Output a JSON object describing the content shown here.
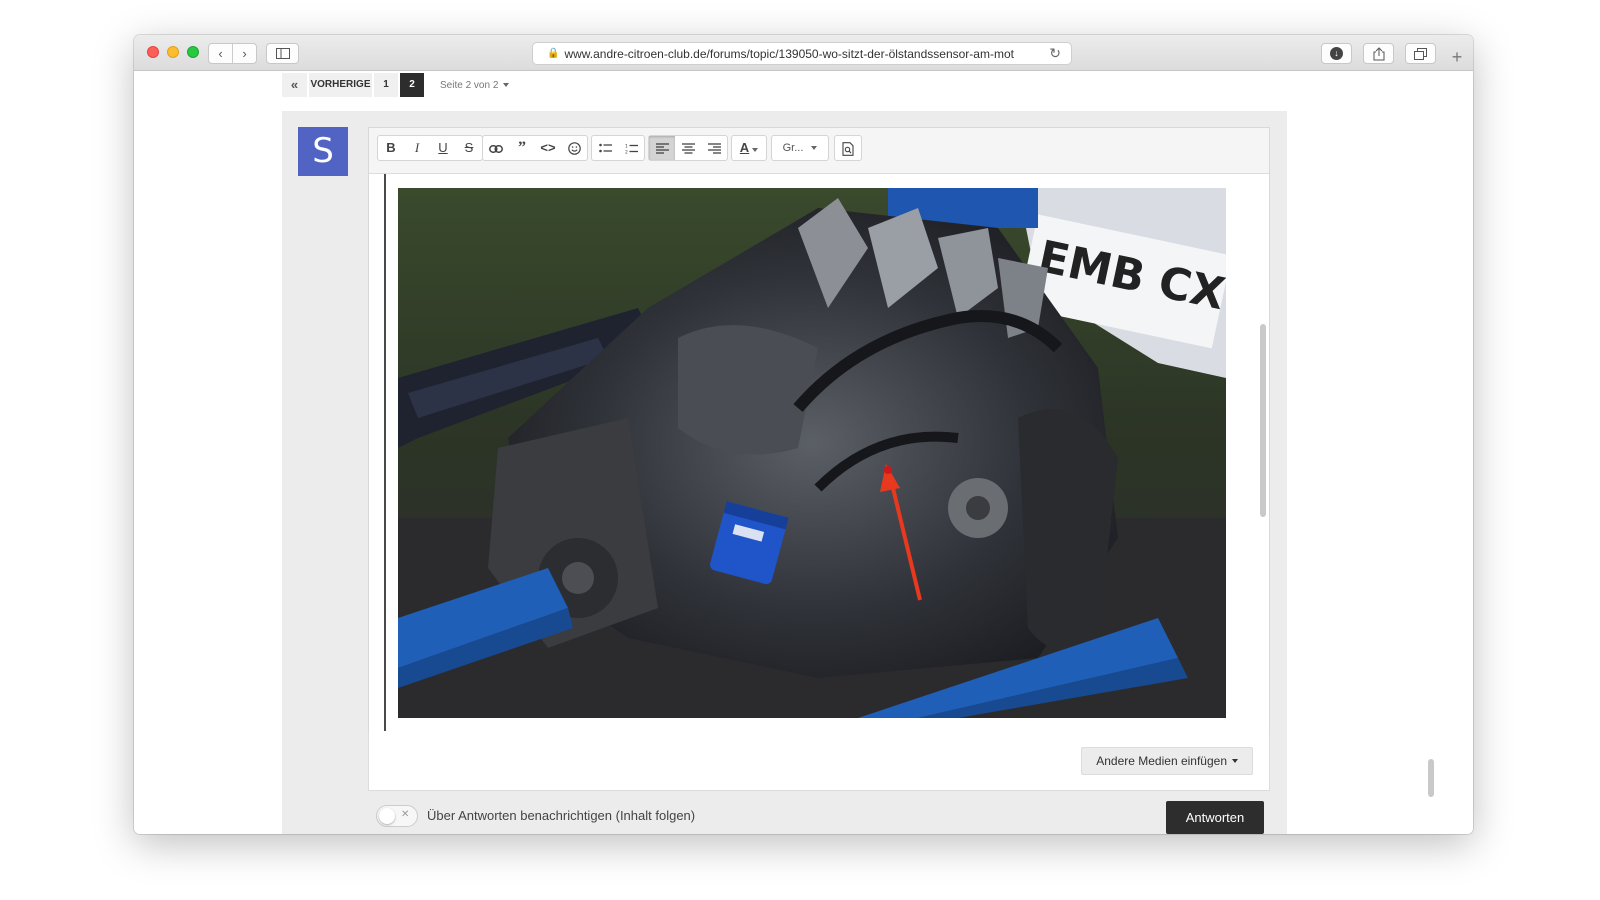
{
  "browser": {
    "url": "www.andre-citroen-club.de/forums/topic/139050-wo-sitzt-der-ölstandssensor-am-mot",
    "icons": [
      "back-icon",
      "forward-icon",
      "sidebar-icon",
      "lock-icon",
      "reload-icon",
      "download-icon",
      "share-icon",
      "tabs-icon",
      "plus-icon"
    ]
  },
  "pagination": {
    "back": "«",
    "previous": "VORHERIGE",
    "pages": [
      "1",
      "2"
    ],
    "current": "2",
    "page_label": "Seite 2 von 2"
  },
  "user": {
    "avatar_letter": "S",
    "avatar_color": "#5264c3"
  },
  "toolbar": {
    "bold": "B",
    "italic": "I",
    "underline": "U",
    "strike": "S",
    "font": "Gr..."
  },
  "editor": {
    "image_alt": "Motor mit rotem Pfeil zum Ölstandssensor"
  },
  "actions": {
    "insert_media": "Andere Medien einfügen",
    "notify_label": "Über Antworten benachrichtigen (Inhalt folgen)",
    "reply": "Antworten"
  },
  "colors": {
    "accent_dark": "#2d2d2d",
    "avatar": "#5264c3",
    "arrow": "#e8391f",
    "engine_stand": "#1f5fb8"
  }
}
